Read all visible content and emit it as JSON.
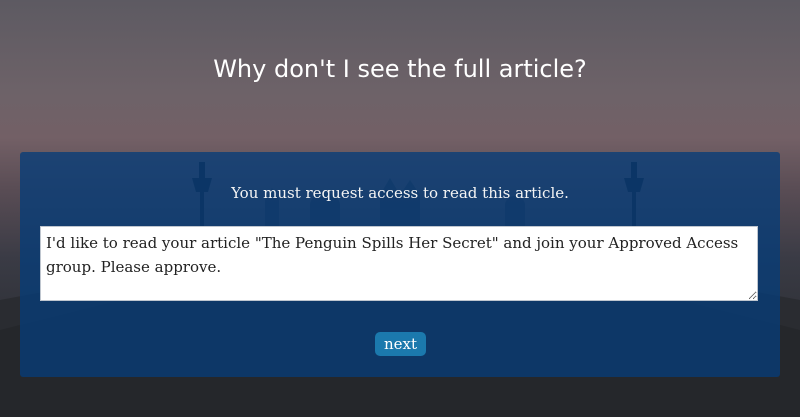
{
  "page": {
    "heading": "Why don't I see the full article?"
  },
  "panel": {
    "message": "You must request access to read this article.",
    "request_text": "I'd like to read your article \"The Penguin Spills Her Secret\" and join your Approved Access group. Please approve.",
    "next_label": "next"
  },
  "colors": {
    "panel_background": "#063c78",
    "button_background": "#1b79ad",
    "text": "#ffffff"
  }
}
